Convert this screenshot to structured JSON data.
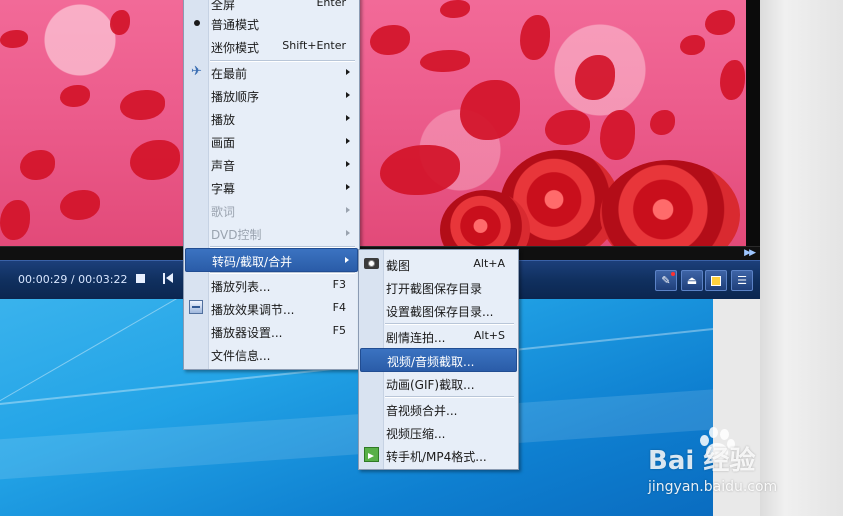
{
  "player": {
    "timecode": "00:00:29 / 00:03:22",
    "seek_arrows": "▶▶",
    "tool_eject": "⏏",
    "tool_menu": "☰"
  },
  "main_menu": {
    "partial_top": {
      "label": "全屏",
      "shortcut": "Enter"
    },
    "items": [
      {
        "label": "普通模式",
        "shortcut": ""
      },
      {
        "label": "迷你模式",
        "shortcut": "Shift+Enter"
      },
      {
        "label": "在最前"
      },
      {
        "label": "播放顺序"
      },
      {
        "label": "播放"
      },
      {
        "label": "画面"
      },
      {
        "label": "声音"
      },
      {
        "label": "字幕"
      },
      {
        "label": "歌词"
      },
      {
        "label": "DVD控制"
      },
      {
        "label": "转码/截取/合并"
      },
      {
        "label": "播放列表...",
        "shortcut": "F3"
      },
      {
        "label": "播放效果调节...",
        "shortcut": "F4"
      },
      {
        "label": "播放器设置...",
        "shortcut": "F5"
      },
      {
        "label": "文件信息..."
      }
    ]
  },
  "sub_menu": {
    "items": [
      {
        "label": "截图",
        "shortcut": "Alt+A"
      },
      {
        "label": "打开截图保存目录"
      },
      {
        "label": "设置截图保存目录..."
      },
      {
        "label": "剧情连拍...",
        "shortcut": "Alt+S"
      },
      {
        "label": "视频/音频截取..."
      },
      {
        "label": "动画(GIF)截取..."
      },
      {
        "label": "音视频合并..."
      },
      {
        "label": "视频压缩..."
      },
      {
        "label": "转手机/MP4格式..."
      }
    ]
  },
  "watermark": {
    "logo": "Bai  经验",
    "url": "jingyan.baidu.com"
  },
  "colors": {
    "menu_bg": "#e7eef8",
    "highlight": "#2a5ca8",
    "controlbar": "#10305f",
    "desktop": "#22a3e6"
  }
}
